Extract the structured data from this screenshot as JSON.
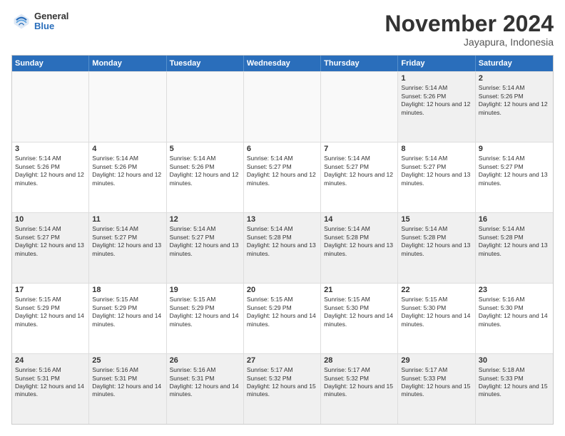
{
  "logo": {
    "general": "General",
    "blue": "Blue"
  },
  "header": {
    "month": "November 2024",
    "location": "Jayapura, Indonesia"
  },
  "weekdays": [
    "Sunday",
    "Monday",
    "Tuesday",
    "Wednesday",
    "Thursday",
    "Friday",
    "Saturday"
  ],
  "rows": [
    [
      {
        "day": "",
        "empty": true
      },
      {
        "day": "",
        "empty": true
      },
      {
        "day": "",
        "empty": true
      },
      {
        "day": "",
        "empty": true
      },
      {
        "day": "",
        "empty": true
      },
      {
        "day": "1",
        "sunrise": "Sunrise: 5:14 AM",
        "sunset": "Sunset: 5:26 PM",
        "daylight": "Daylight: 12 hours and 12 minutes."
      },
      {
        "day": "2",
        "sunrise": "Sunrise: 5:14 AM",
        "sunset": "Sunset: 5:26 PM",
        "daylight": "Daylight: 12 hours and 12 minutes."
      }
    ],
    [
      {
        "day": "3",
        "sunrise": "Sunrise: 5:14 AM",
        "sunset": "Sunset: 5:26 PM",
        "daylight": "Daylight: 12 hours and 12 minutes."
      },
      {
        "day": "4",
        "sunrise": "Sunrise: 5:14 AM",
        "sunset": "Sunset: 5:26 PM",
        "daylight": "Daylight: 12 hours and 12 minutes."
      },
      {
        "day": "5",
        "sunrise": "Sunrise: 5:14 AM",
        "sunset": "Sunset: 5:26 PM",
        "daylight": "Daylight: 12 hours and 12 minutes."
      },
      {
        "day": "6",
        "sunrise": "Sunrise: 5:14 AM",
        "sunset": "Sunset: 5:27 PM",
        "daylight": "Daylight: 12 hours and 12 minutes."
      },
      {
        "day": "7",
        "sunrise": "Sunrise: 5:14 AM",
        "sunset": "Sunset: 5:27 PM",
        "daylight": "Daylight: 12 hours and 12 minutes."
      },
      {
        "day": "8",
        "sunrise": "Sunrise: 5:14 AM",
        "sunset": "Sunset: 5:27 PM",
        "daylight": "Daylight: 12 hours and 13 minutes."
      },
      {
        "day": "9",
        "sunrise": "Sunrise: 5:14 AM",
        "sunset": "Sunset: 5:27 PM",
        "daylight": "Daylight: 12 hours and 13 minutes."
      }
    ],
    [
      {
        "day": "10",
        "sunrise": "Sunrise: 5:14 AM",
        "sunset": "Sunset: 5:27 PM",
        "daylight": "Daylight: 12 hours and 13 minutes."
      },
      {
        "day": "11",
        "sunrise": "Sunrise: 5:14 AM",
        "sunset": "Sunset: 5:27 PM",
        "daylight": "Daylight: 12 hours and 13 minutes."
      },
      {
        "day": "12",
        "sunrise": "Sunrise: 5:14 AM",
        "sunset": "Sunset: 5:27 PM",
        "daylight": "Daylight: 12 hours and 13 minutes."
      },
      {
        "day": "13",
        "sunrise": "Sunrise: 5:14 AM",
        "sunset": "Sunset: 5:28 PM",
        "daylight": "Daylight: 12 hours and 13 minutes."
      },
      {
        "day": "14",
        "sunrise": "Sunrise: 5:14 AM",
        "sunset": "Sunset: 5:28 PM",
        "daylight": "Daylight: 12 hours and 13 minutes."
      },
      {
        "day": "15",
        "sunrise": "Sunrise: 5:14 AM",
        "sunset": "Sunset: 5:28 PM",
        "daylight": "Daylight: 12 hours and 13 minutes."
      },
      {
        "day": "16",
        "sunrise": "Sunrise: 5:14 AM",
        "sunset": "Sunset: 5:28 PM",
        "daylight": "Daylight: 12 hours and 13 minutes."
      }
    ],
    [
      {
        "day": "17",
        "sunrise": "Sunrise: 5:15 AM",
        "sunset": "Sunset: 5:29 PM",
        "daylight": "Daylight: 12 hours and 14 minutes."
      },
      {
        "day": "18",
        "sunrise": "Sunrise: 5:15 AM",
        "sunset": "Sunset: 5:29 PM",
        "daylight": "Daylight: 12 hours and 14 minutes."
      },
      {
        "day": "19",
        "sunrise": "Sunrise: 5:15 AM",
        "sunset": "Sunset: 5:29 PM",
        "daylight": "Daylight: 12 hours and 14 minutes."
      },
      {
        "day": "20",
        "sunrise": "Sunrise: 5:15 AM",
        "sunset": "Sunset: 5:29 PM",
        "daylight": "Daylight: 12 hours and 14 minutes."
      },
      {
        "day": "21",
        "sunrise": "Sunrise: 5:15 AM",
        "sunset": "Sunset: 5:30 PM",
        "daylight": "Daylight: 12 hours and 14 minutes."
      },
      {
        "day": "22",
        "sunrise": "Sunrise: 5:15 AM",
        "sunset": "Sunset: 5:30 PM",
        "daylight": "Daylight: 12 hours and 14 minutes."
      },
      {
        "day": "23",
        "sunrise": "Sunrise: 5:16 AM",
        "sunset": "Sunset: 5:30 PM",
        "daylight": "Daylight: 12 hours and 14 minutes."
      }
    ],
    [
      {
        "day": "24",
        "sunrise": "Sunrise: 5:16 AM",
        "sunset": "Sunset: 5:31 PM",
        "daylight": "Daylight: 12 hours and 14 minutes."
      },
      {
        "day": "25",
        "sunrise": "Sunrise: 5:16 AM",
        "sunset": "Sunset: 5:31 PM",
        "daylight": "Daylight: 12 hours and 14 minutes."
      },
      {
        "day": "26",
        "sunrise": "Sunrise: 5:16 AM",
        "sunset": "Sunset: 5:31 PM",
        "daylight": "Daylight: 12 hours and 14 minutes."
      },
      {
        "day": "27",
        "sunrise": "Sunrise: 5:17 AM",
        "sunset": "Sunset: 5:32 PM",
        "daylight": "Daylight: 12 hours and 15 minutes."
      },
      {
        "day": "28",
        "sunrise": "Sunrise: 5:17 AM",
        "sunset": "Sunset: 5:32 PM",
        "daylight": "Daylight: 12 hours and 15 minutes."
      },
      {
        "day": "29",
        "sunrise": "Sunrise: 5:17 AM",
        "sunset": "Sunset: 5:33 PM",
        "daylight": "Daylight: 12 hours and 15 minutes."
      },
      {
        "day": "30",
        "sunrise": "Sunrise: 5:18 AM",
        "sunset": "Sunset: 5:33 PM",
        "daylight": "Daylight: 12 hours and 15 minutes."
      }
    ]
  ]
}
